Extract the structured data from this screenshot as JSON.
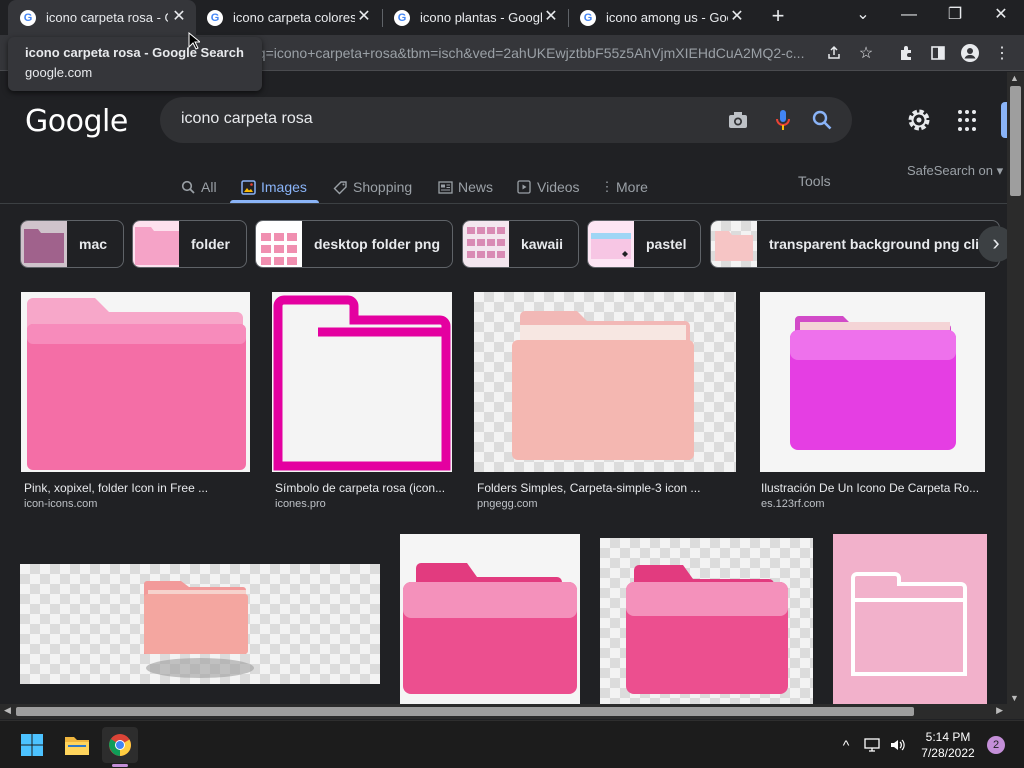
{
  "tabs": [
    {
      "title": "icono carpeta rosa - Google Search",
      "active": true
    },
    {
      "title": "icono carpeta colores - Google Search",
      "active": false
    },
    {
      "title": "icono plantas - Google Search",
      "active": false
    },
    {
      "title": "icono among us - Google Search",
      "active": false
    }
  ],
  "tooltip": {
    "title": "icono carpeta rosa - Google Search",
    "domain": "google.com"
  },
  "omnibox": {
    "url_fragment": "?q=icono+carpeta+rosa&tbm=isch&ved=2ahUKEwjztbbF55z5AhVjmXIEHdCuA2MQ2-c..."
  },
  "google": {
    "logo": "Google",
    "query": "icono carpeta rosa",
    "nav": [
      {
        "label": "All",
        "icon": "search-icon"
      },
      {
        "label": "Images",
        "icon": "image-icon",
        "active": true
      },
      {
        "label": "Shopping",
        "icon": "tag-icon"
      },
      {
        "label": "News",
        "icon": "news-icon"
      },
      {
        "label": "Videos",
        "icon": "play-icon"
      },
      {
        "label": "More",
        "icon": "more-vertical-icon"
      }
    ],
    "tools": "Tools",
    "safesearch": "SafeSearch on"
  },
  "chips": [
    {
      "label": "mac",
      "color": "#a0628c"
    },
    {
      "label": "folder",
      "color": "#f5a3c7"
    },
    {
      "label": "desktop folder png",
      "color": "#f2b8cc"
    },
    {
      "label": "kawaii",
      "color": "#e9c6da"
    },
    {
      "label": "pastel",
      "color": "#f7c6e4"
    },
    {
      "label": "transparent background png clip art",
      "color": "#f6c5c5"
    }
  ],
  "results": [
    {
      "caption": "Pink, xopixel, folder Icon in Free ...",
      "source": "icon-icons.com"
    },
    {
      "caption": "Símbolo de carpeta rosa (icon...",
      "source": "icones.pro"
    },
    {
      "caption": "Folders Simples, Carpeta-simple-3 icon ...",
      "source": "pngegg.com"
    },
    {
      "caption": "Ilustración De Un Icono De Carpeta Ro...",
      "source": "es.123rf.com"
    }
  ],
  "taskbar": {
    "time": "5:14 PM",
    "date": "7/28/2022",
    "notifications": "2"
  },
  "colors": {
    "accent": "#8ab4f8",
    "background": "#202124",
    "pink": "#f472ab",
    "magenta": "#e400a0"
  }
}
